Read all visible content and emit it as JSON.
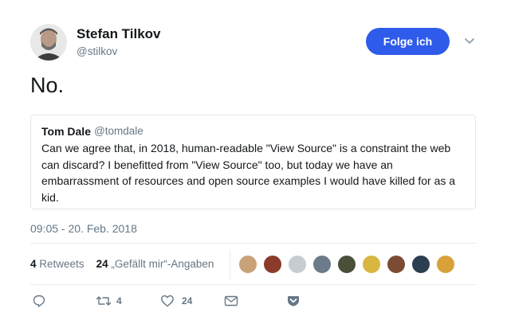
{
  "author": {
    "name": "Stefan Tilkov",
    "handle": "@stilkov",
    "follow_label": "Folge ich"
  },
  "tweet": {
    "text": "No."
  },
  "quoted": {
    "name": "Tom Dale",
    "handle": "@tomdale",
    "text": "Can we agree that, in 2018, human-readable \"View Source\" is a constraint the web can discard? I benefitted from \"View Source\" too, but today we have an embarrassment of resources and open source examples I would have killed for as a kid."
  },
  "timestamp": "09:05 - 20. Feb. 2018",
  "stats": {
    "retweets_count": "4",
    "retweets_label": "Retweets",
    "likes_count": "24",
    "likes_label": "„Gefällt mir“-Angaben"
  },
  "likers": [
    {
      "icon": "avatar-1",
      "color": "#c9a27a"
    },
    {
      "icon": "avatar-2",
      "color": "#8a3b2a"
    },
    {
      "icon": "avatar-3",
      "color": "#c7ccd1"
    },
    {
      "icon": "avatar-4",
      "color": "#6c7a89"
    },
    {
      "icon": "avatar-5",
      "color": "#4a4f3a"
    },
    {
      "icon": "avatar-6",
      "color": "#d8b640"
    },
    {
      "icon": "avatar-7",
      "color": "#7b4b34"
    },
    {
      "icon": "avatar-8",
      "color": "#2c3e50"
    },
    {
      "icon": "avatar-9",
      "color": "#d9a13a"
    }
  ],
  "actions": {
    "reply_icon": "reply-icon",
    "retweet_icon": "retweet-icon",
    "retweet_count": "4",
    "like_icon": "heart-icon",
    "like_count": "24",
    "dm_icon": "envelope-icon",
    "save_icon": "pocket-icon"
  },
  "colors": {
    "accent": "#2f5bea",
    "muted": "#657786",
    "text": "#14171a",
    "border": "#e1e8ed"
  }
}
